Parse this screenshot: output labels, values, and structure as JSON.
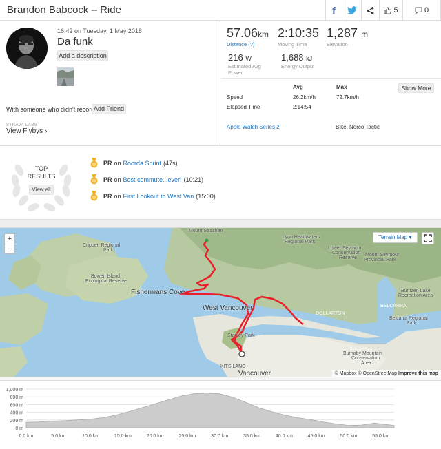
{
  "header": {
    "title": "Brandon Babcock – Ride",
    "share_facebook": "f",
    "kudos_count": "5",
    "comment_count": "0"
  },
  "activity": {
    "date": "16:42 on Tuesday, 1 May 2018",
    "name": "Da funk",
    "add_description_label": "Add a description",
    "with_someone_text": "With someone who didn't record?",
    "add_friend_label": "Add Friend",
    "labs_label": "STRAVA LABS",
    "view_flybys_label": "View Flybys ›"
  },
  "stats": {
    "distance": {
      "value": "57.06",
      "unit": "km",
      "label": "Distance (?)"
    },
    "moving_time": {
      "value": "2:10:35",
      "label": "Moving Time"
    },
    "elevation": {
      "value": "1,287",
      "unit": "m",
      "label": "Elevation"
    },
    "power": {
      "value": "216",
      "unit": "W",
      "label1": "Estimated Avg",
      "label2": "Power"
    },
    "energy": {
      "value": "1,688",
      "unit": "kJ",
      "label": "Energy Output"
    },
    "table_headers": {
      "avg": "Avg",
      "max": "Max"
    },
    "show_more_label": "Show More",
    "speed": {
      "label": "Speed",
      "avg": "26.2km/h",
      "max": "72.7km/h"
    },
    "elapsed": {
      "label": "Elapsed Time",
      "avg": "2:14:54"
    },
    "device": "Apple Watch Series 2",
    "bike": "Bike: Norco Tactic"
  },
  "top_results": {
    "heading1": "TOP",
    "heading2": "RESULTS",
    "view_all_label": "View all",
    "items": [
      {
        "badge": "PR",
        "on": "on",
        "segment": "Roorda Sprint",
        "time": "(47s)"
      },
      {
        "badge": "PR",
        "on": "on",
        "segment": "Best commute...ever!",
        "time": "(10:21)"
      },
      {
        "badge": "PR",
        "on": "on",
        "segment": "First Lookout to West Van",
        "time": "(15:00)"
      }
    ]
  },
  "map": {
    "terrain_label": "Terrain Map ▾",
    "zoom_in": "+",
    "zoom_out": "−",
    "labels": {
      "mount_strachan": "Mount Strachan",
      "lynn_headwaters": "Lynn Headwaters",
      "regional_park": "Regional Park",
      "lower_seymour": "Lower Seymour",
      "conservation": "Conservation",
      "reserve": "Reserve",
      "mount_seymour": "Mount Seymour",
      "provincial_park": "Provincial Park",
      "crippen": "Crippen Regional",
      "park": "Park",
      "bowen": "Bowen Island",
      "ecological": "Ecological Reserve",
      "fishermans": "Fishermans Cove",
      "west_vancouver": "West Vancouver",
      "stanley": "Stanley Park",
      "buntzen": "Buntzen Lake",
      "recreation": "Recreation Area",
      "belcarra": "Belcarra Regional",
      "belcarra_park": "Park",
      "burnaby": "Burnaby Mountain",
      "burnaby2": "Conservation",
      "burnaby3": "Area",
      "vancouver": "Vancouver",
      "kitsilano": "KITSILANO",
      "indian_arm": "BELCARRA",
      "dollarton": "DOLLARTON"
    },
    "attribution_mapbox": "© Mapbox",
    "attribution_osm": "© OpenStreetMap",
    "attribution_improve": "Improve this map",
    "colors": {
      "route": "#e8202a",
      "water": "#9fcbe8",
      "land": "#d8e2c6",
      "forest": "#a8c08a"
    }
  },
  "elevation_chart": {
    "y_ticks": [
      "1,000 m",
      "800 m",
      "600 m",
      "400 m",
      "200 m",
      "0 m"
    ],
    "x_ticks": [
      "0.0 km",
      "5.0 km",
      "10.0 km",
      "15.0 km",
      "20.0 km",
      "25.0 km",
      "30.0 km",
      "35.0 km",
      "40.0 km",
      "45.0 km",
      "50.0 km",
      "55.0 km"
    ],
    "profile_km": [
      0,
      2,
      4,
      6,
      8,
      10,
      12,
      14,
      16,
      18,
      20,
      22,
      24,
      26,
      28,
      30,
      32,
      34,
      36,
      38,
      40,
      42,
      44,
      46,
      48,
      50,
      52,
      54,
      56,
      57.06
    ],
    "profile_m": [
      140,
      150,
      170,
      180,
      200,
      220,
      260,
      330,
      420,
      520,
      620,
      720,
      820,
      880,
      900,
      880,
      790,
      660,
      520,
      420,
      330,
      260,
      210,
      150,
      100,
      60,
      70,
      120,
      80,
      60
    ],
    "colors": {
      "fill": "#cccccc",
      "stroke": "#aaaaaa"
    }
  }
}
